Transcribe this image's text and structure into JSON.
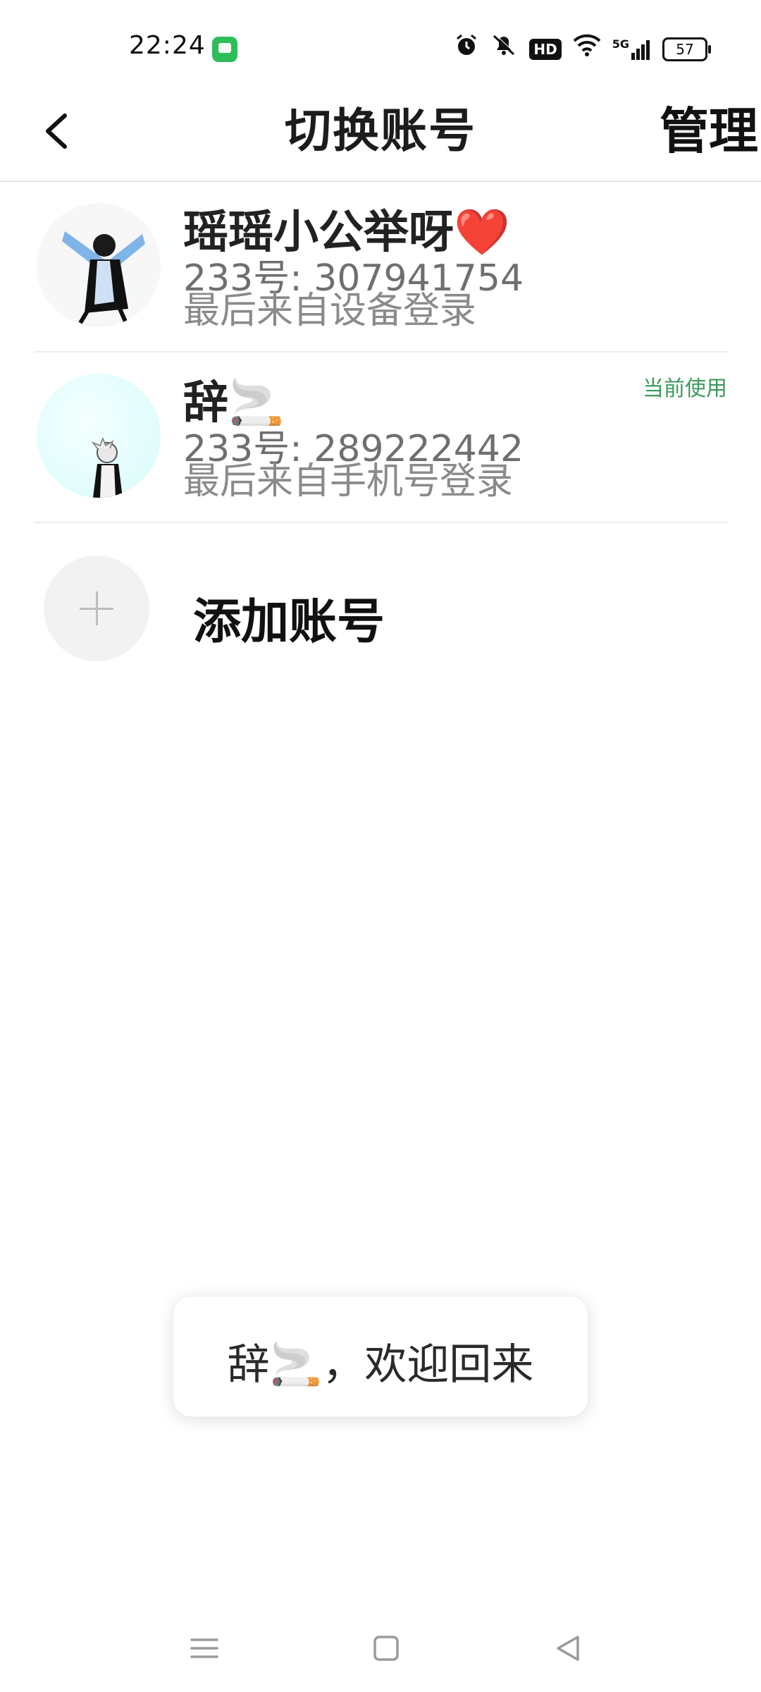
{
  "status_bar": {
    "time": "22:24",
    "icons": [
      "message-app-icon",
      "alarm-icon",
      "mute-icon",
      "hd-icon",
      "wifi-icon",
      "5g-signal-icon",
      "battery-icon"
    ],
    "hd_label": "HD",
    "network_label": "5G",
    "battery_level": "57"
  },
  "header": {
    "title": "切换账号",
    "manage_label": "管理",
    "back_icon": "chevron-left-icon"
  },
  "accounts": [
    {
      "name": "瑶瑶小公举呀❤️",
      "id_text": "233号: 307941754",
      "last_login": "最后来自设备登录",
      "current_label": ""
    },
    {
      "name": "辞🚬",
      "id_text": "233号: 289222442",
      "last_login": "最后来自手机号登录",
      "current_label": "当前使用"
    }
  ],
  "add_account": {
    "label": "添加账号",
    "icon": "plus-icon"
  },
  "toast": {
    "text": "辞🚬，欢迎回来"
  },
  "nav_bar": {
    "icons": [
      "menu-icon",
      "home-icon",
      "back-triangle-icon"
    ]
  },
  "colors": {
    "accent_green": "#3a9a5a",
    "divider": "#ececec",
    "secondary_text": "#6f6f6f"
  }
}
